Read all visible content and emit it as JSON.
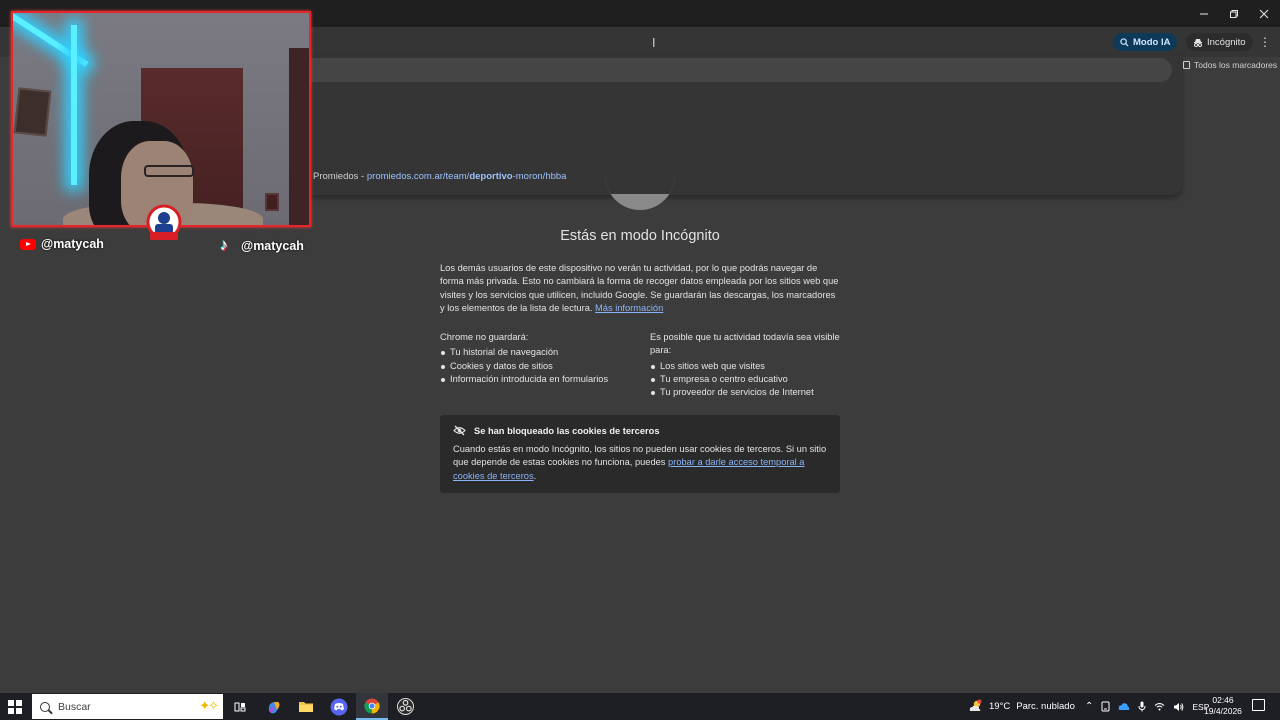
{
  "window": {
    "minimize_icon": "minimize-icon",
    "maximize_icon": "restore-icon",
    "close_icon": "close-icon"
  },
  "toolbar": {
    "ai_mode_label": "Modo IA",
    "incognito_label": "Incógnito",
    "bookmarks_label": "Todos los marcadores"
  },
  "omnibox": {
    "suggestion_site": "Promiedos",
    "suggestion_separator": " - ",
    "suggestion_url_prefix": "promiedos.com.ar/team/",
    "suggestion_url_bold": "deportivo",
    "suggestion_url_suffix": "-moron/hbba"
  },
  "page": {
    "title": "Estás en modo Incógnito",
    "intro": "Los demás usuarios de este dispositivo no verán tu actividad, por lo que podrás navegar de forma más privada. Esto no cambiará la forma de recoger datos empleada por los sitios web que visites y los servicios que utilicen, incluido Google. Se guardarán las descargas, los marcadores y los elementos de la lista de lectura.",
    "more_info_link": "Más información",
    "not_saved_heading": "Chrome no guardará:",
    "not_saved_items": [
      "Tu historial de navegación",
      "Cookies y datos de sitios",
      "Información introducida en formularios"
    ],
    "visible_heading": "Es posible que tu actividad todavía sea visible para:",
    "visible_items": [
      "Los sitios web que visites",
      "Tu empresa o centro educativo",
      "Tu proveedor de servicios de Internet"
    ],
    "cookie_heading": "Se han bloqueado las cookies de terceros",
    "cookie_body": "Cuando estás en modo Incógnito, los sitios no pueden usar cookies de terceros. Si un sitio que depende de estas cookies no funciona, puedes",
    "cookie_link": "probar a darle acceso temporal a cookies de terceros",
    "cookie_end": "."
  },
  "overlay": {
    "youtube_handle": "@matycah",
    "tiktok_handle": "@matycah"
  },
  "taskbar": {
    "search_placeholder": "Buscar",
    "apps": [
      "task-view-icon",
      "copilot-icon",
      "file-explorer-icon",
      "discord-icon",
      "chrome-icon",
      "obs-icon"
    ],
    "weather_temp": "19°C",
    "weather_desc": "Parc. nublado",
    "language": "ESP",
    "time": "02:46",
    "date": "19/4/2026"
  },
  "colors": {
    "page_bg": "#3c3c3c",
    "link": "#8ab4f8",
    "cam_border": "#e8252a",
    "ai_button_bg": "#0e3a5a"
  }
}
